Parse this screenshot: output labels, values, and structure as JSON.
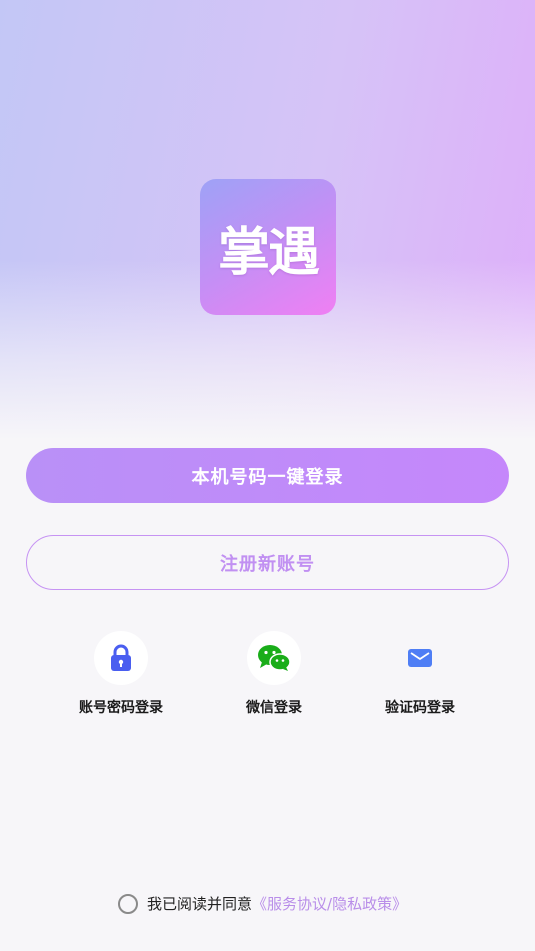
{
  "app": {
    "logo_text": "掌遇"
  },
  "actions": {
    "one_click_login": "本机号码一键登录",
    "register": "注册新账号"
  },
  "alt_logins": [
    {
      "label": "账号密码登录",
      "icon": "lock-icon"
    },
    {
      "label": "微信登录",
      "icon": "wechat-icon"
    },
    {
      "label": "验证码登录",
      "icon": "mail-icon"
    }
  ],
  "agreement": {
    "prefix": "我已阅读并同意",
    "link": "《服务协议/隐私政策》",
    "checked": false
  },
  "colors": {
    "accent": "#c08af8",
    "link": "#b98ee9",
    "lock_icon": "#4a5ef0",
    "wechat_icon": "#1aad19",
    "mail_icon": "#4f7ef5"
  }
}
